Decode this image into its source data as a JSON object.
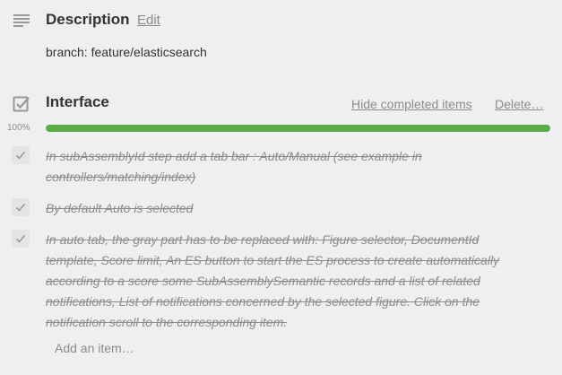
{
  "description": {
    "icon": "description-icon",
    "title": "Description",
    "edit_label": "Edit",
    "text": "branch: feature/elasticsearch"
  },
  "checklist": {
    "icon": "checklist-icon",
    "title": "Interface",
    "hide_completed_label": "Hide completed items",
    "delete_label": "Delete…",
    "progress_percent_label": "100%",
    "progress_fraction": 1.0,
    "progress_color": "#5aac44",
    "items": [
      {
        "text": "In subAssemblyId step add a tab bar : Auto/Manual (see example in controllers/matching/index)",
        "checked": true
      },
      {
        "text": "By default Auto is selected",
        "checked": true
      },
      {
        "text": "In auto tab, the gray part has to be replaced with: Figure selector, DocumentId template, Score limit, An ES button to start the ES process to create automatically according to a score some SubAssemblySemantic records and a list of related notifications, List of notifications concerned by the selected figure. Click on the notification scroll to the corresponding item.",
        "checked": true
      }
    ],
    "add_item_label": "Add an item…"
  }
}
